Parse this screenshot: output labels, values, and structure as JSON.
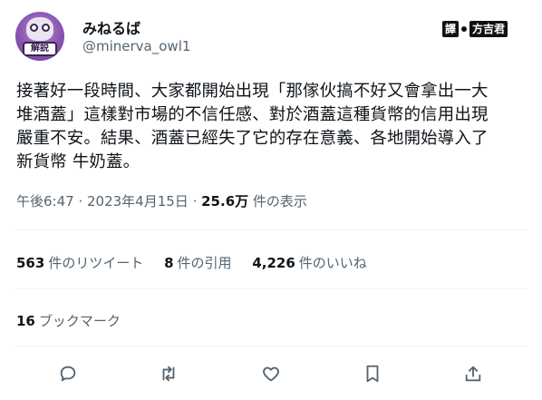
{
  "author": {
    "display_name": "みねるば",
    "handle": "@minerva_owl1",
    "avatar_badge_text": "解説"
  },
  "stamp": {
    "left_text": "譯",
    "right_text": "方吉君"
  },
  "tweet": {
    "lines": [
      "接著好一段時間、大家都開始出現「那傢伙搞不好又會拿出一大",
      "堆酒蓋」這樣對市場的不信任感、對於酒蓋這種貨幣的信用出現",
      "嚴重不安。結果、酒蓋已經失了它的存在意義、各地開始導入了",
      "新貨幣 牛奶蓋。"
    ]
  },
  "meta": {
    "time": "午後6:47",
    "sep1": " · ",
    "date": "2023年4月15日",
    "sep2": " · ",
    "views_count": "25.6万",
    "views_label": " 件の表示"
  },
  "stats": {
    "retweets_count": "563",
    "retweets_label": "件のリツイート",
    "quotes_count": "8",
    "quotes_label": "件の引用",
    "likes_count": "4,226",
    "likes_label": "件のいいね"
  },
  "bookmarks": {
    "count": "16",
    "label": "ブックマーク"
  },
  "actions": {
    "icons": [
      "reply-icon",
      "retweet-icon",
      "like-icon",
      "bookmark-icon",
      "share-icon"
    ]
  }
}
